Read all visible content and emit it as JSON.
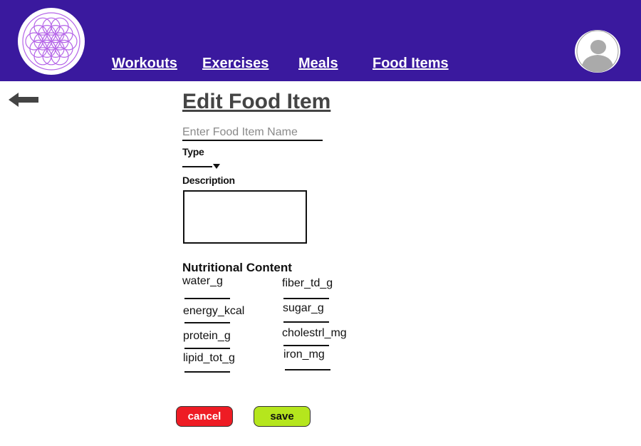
{
  "header": {
    "nav": [
      {
        "label": "Workouts"
      },
      {
        "label": "Exercises"
      },
      {
        "label": "Meals"
      },
      {
        "label": "Food Items"
      }
    ]
  },
  "form": {
    "title": "Edit Food Item",
    "name_placeholder": "Enter Food Item Name",
    "name_value": "",
    "type_label": "Type",
    "type_value": "",
    "description_label": "Description",
    "description_value": "",
    "nutrition_title": "Nutritional Content",
    "nutrition_fields": [
      {
        "label": "water_g"
      },
      {
        "label": "energy_kcal"
      },
      {
        "label": "protein_g"
      },
      {
        "label": "lipid_tot_g"
      },
      {
        "label": "fiber_td_g"
      },
      {
        "label": "sugar_g"
      },
      {
        "label": "cholestrl_mg"
      },
      {
        "label": "iron_mg"
      }
    ]
  },
  "actions": {
    "cancel_label": "cancel",
    "save_label": "save"
  },
  "colors": {
    "header": "#3a199e",
    "logo": "#b565e8",
    "cancel": "#ee1c24",
    "save": "#b5e61d",
    "title": "#444444"
  },
  "icons": {
    "logo": "flower-of-life-logo-icon",
    "avatar": "user-avatar-icon",
    "back": "back-arrow-icon",
    "dropdown": "dropdown-triangle-icon"
  }
}
